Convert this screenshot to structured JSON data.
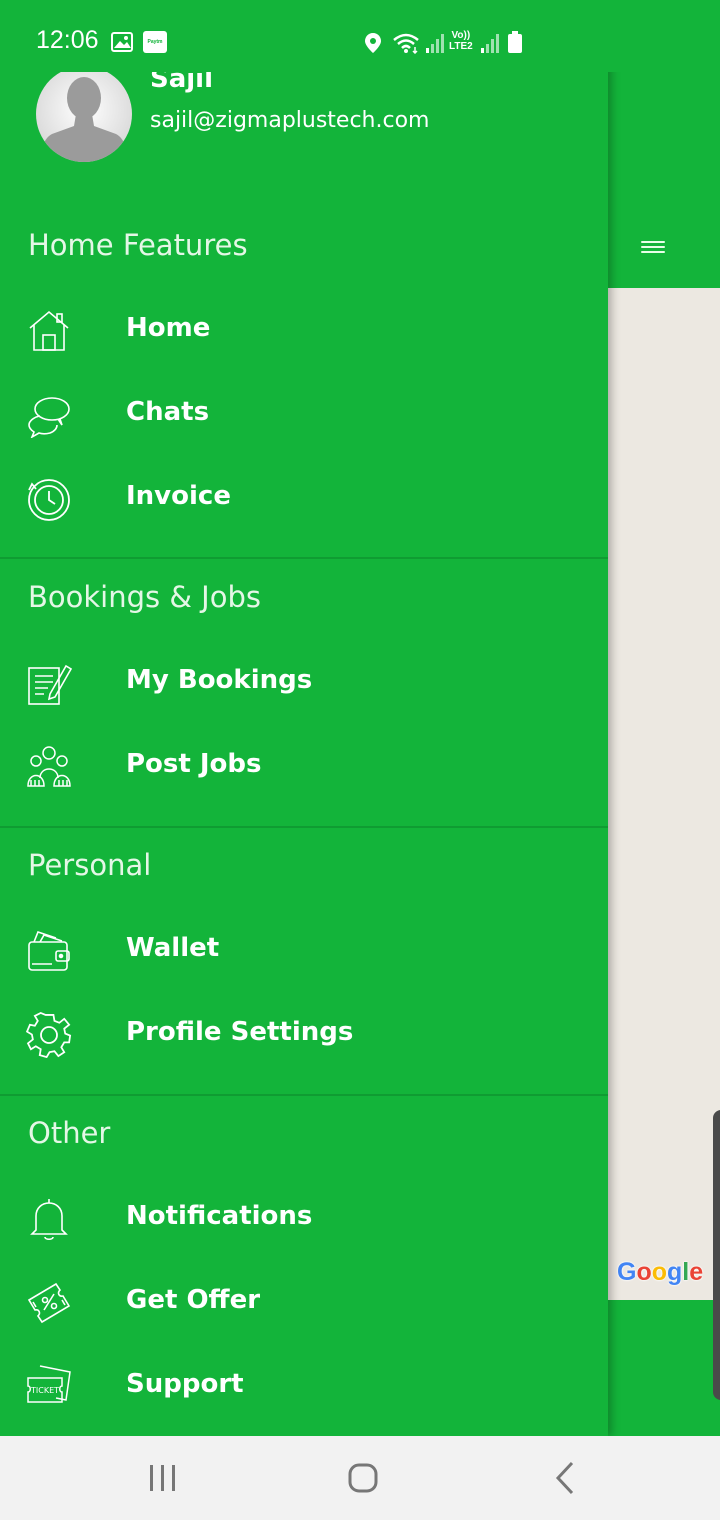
{
  "status_bar": {
    "time": "12:06",
    "carrier_badge": "Paytm",
    "volte_label": "Vo))",
    "lte_label": "LTE2"
  },
  "drawer": {
    "user": {
      "name": "Sajil",
      "email": "sajil@zigmaplustech.com"
    },
    "sections": [
      {
        "title": "Home Features",
        "items": [
          {
            "label": "Home",
            "icon": "home-icon"
          },
          {
            "label": "Chats",
            "icon": "chat-bubbles-icon"
          },
          {
            "label": "Invoice",
            "icon": "clock-history-icon"
          }
        ]
      },
      {
        "title": "Bookings & Jobs",
        "items": [
          {
            "label": "My Bookings",
            "icon": "edit-document-icon"
          },
          {
            "label": "Post Jobs",
            "icon": "team-icon"
          }
        ]
      },
      {
        "title": "Personal",
        "items": [
          {
            "label": "Wallet",
            "icon": "wallet-icon"
          },
          {
            "label": "Profile Settings",
            "icon": "gear-icon"
          }
        ]
      },
      {
        "title": "Other",
        "items": [
          {
            "label": "Notifications",
            "icon": "bell-icon"
          },
          {
            "label": "Get Offer",
            "icon": "discount-tag-icon"
          },
          {
            "label": "Support",
            "icon": "ticket-icon"
          }
        ]
      }
    ]
  },
  "map": {
    "attribution": "Google"
  },
  "colors": {
    "primary": "#13b43a",
    "divider": "#0f9c32",
    "map_bg": "#ece8e1",
    "nav_bg": "#f2f2f2"
  }
}
